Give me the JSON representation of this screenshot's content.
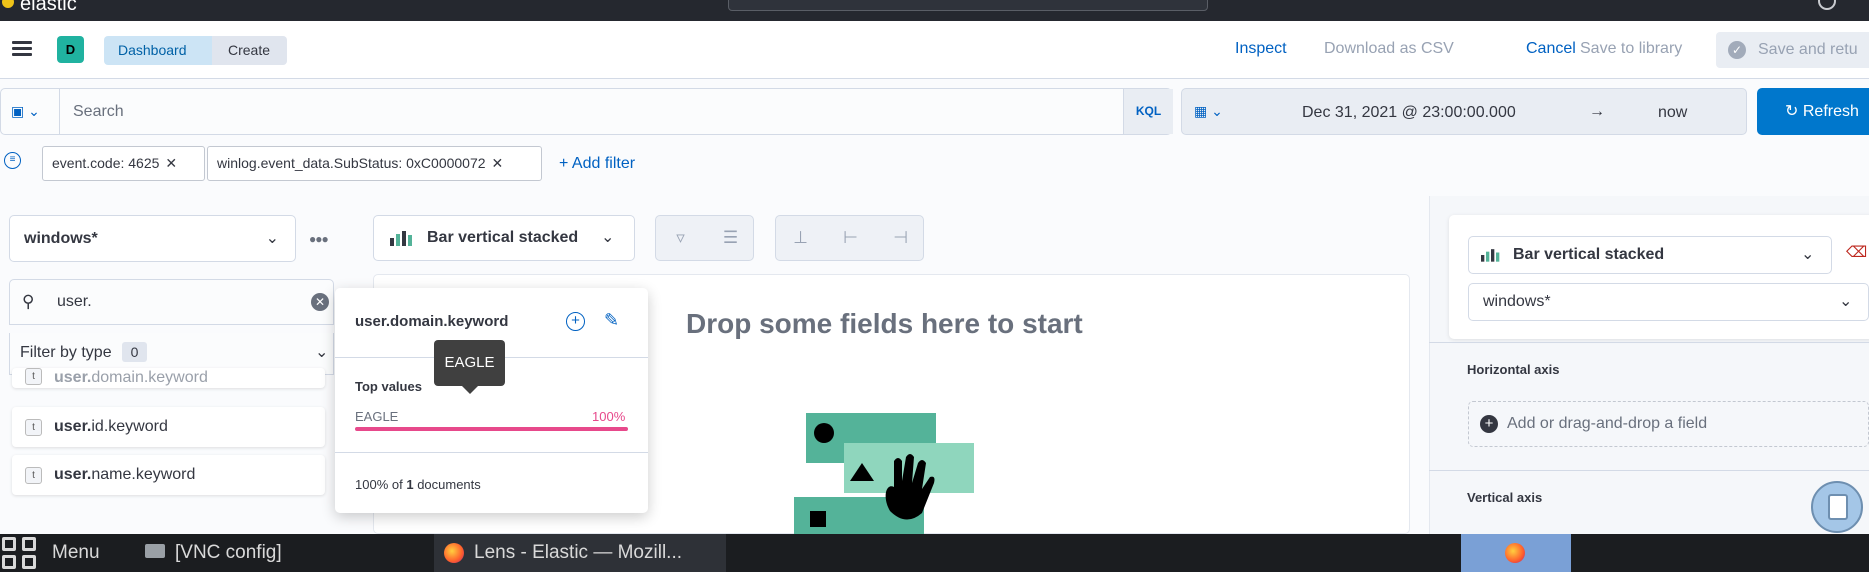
{
  "app": {
    "logo_text": "elastic"
  },
  "breadcrumb": {
    "avatar": "D",
    "items": [
      "Dashboard",
      "Create"
    ]
  },
  "header_actions": {
    "inspect": "Inspect",
    "download_csv": "Download as CSV",
    "cancel": "Cancel",
    "save_library": "Save to library",
    "save_return": "Save and retu"
  },
  "query": {
    "placeholder": "Search",
    "language": "KQL",
    "date_start": "Dec 31, 2021 @ 23:00:00.000",
    "date_arrow": "→",
    "date_end": "now",
    "refresh": "Refresh"
  },
  "filters": {
    "pills": [
      "event.code: 4625",
      "winlog.event_data.SubStatus: 0xC0000072"
    ],
    "add_label": "+ Add filter"
  },
  "datasource": {
    "selected": "windows*",
    "search_value": "user.",
    "filter_by_type": "Filter by type",
    "filter_count": "0",
    "fields": [
      {
        "prefix": "user.",
        "rest": "domain.keyword",
        "type": "t"
      },
      {
        "prefix": "user.",
        "rest": "id.keyword",
        "type": "t"
      },
      {
        "prefix": "user.",
        "rest": "name.keyword",
        "type": "t"
      }
    ]
  },
  "popover": {
    "field_name": "user.domain.keyword",
    "section": "Top values",
    "top_value": "EAGLE",
    "top_pct": "100%",
    "top_fraction": 1.0,
    "footer_pct": "100% of",
    "footer_count": "1",
    "footer_suffix": "documents",
    "tooltip": "EAGLE"
  },
  "workspace": {
    "chart_type": "Bar vertical stacked",
    "drop_title": "Drop some fields here to start"
  },
  "config_panel": {
    "chart_type": "Bar vertical stacked",
    "datasource": "windows*",
    "horizontal_axis": "Horizontal axis",
    "add_field": "Add or drag-and-drop a field",
    "vertical_axis": "Vertical axis"
  },
  "taskbar": {
    "menu": "Menu",
    "vnc": "[VNC config]",
    "window": "Lens - Elastic — Mozill..."
  },
  "colors": {
    "accent": "#0061c2",
    "primary_button": "#0077cc",
    "top_value_bar": "#e7498b",
    "illustration": "#54b399"
  }
}
